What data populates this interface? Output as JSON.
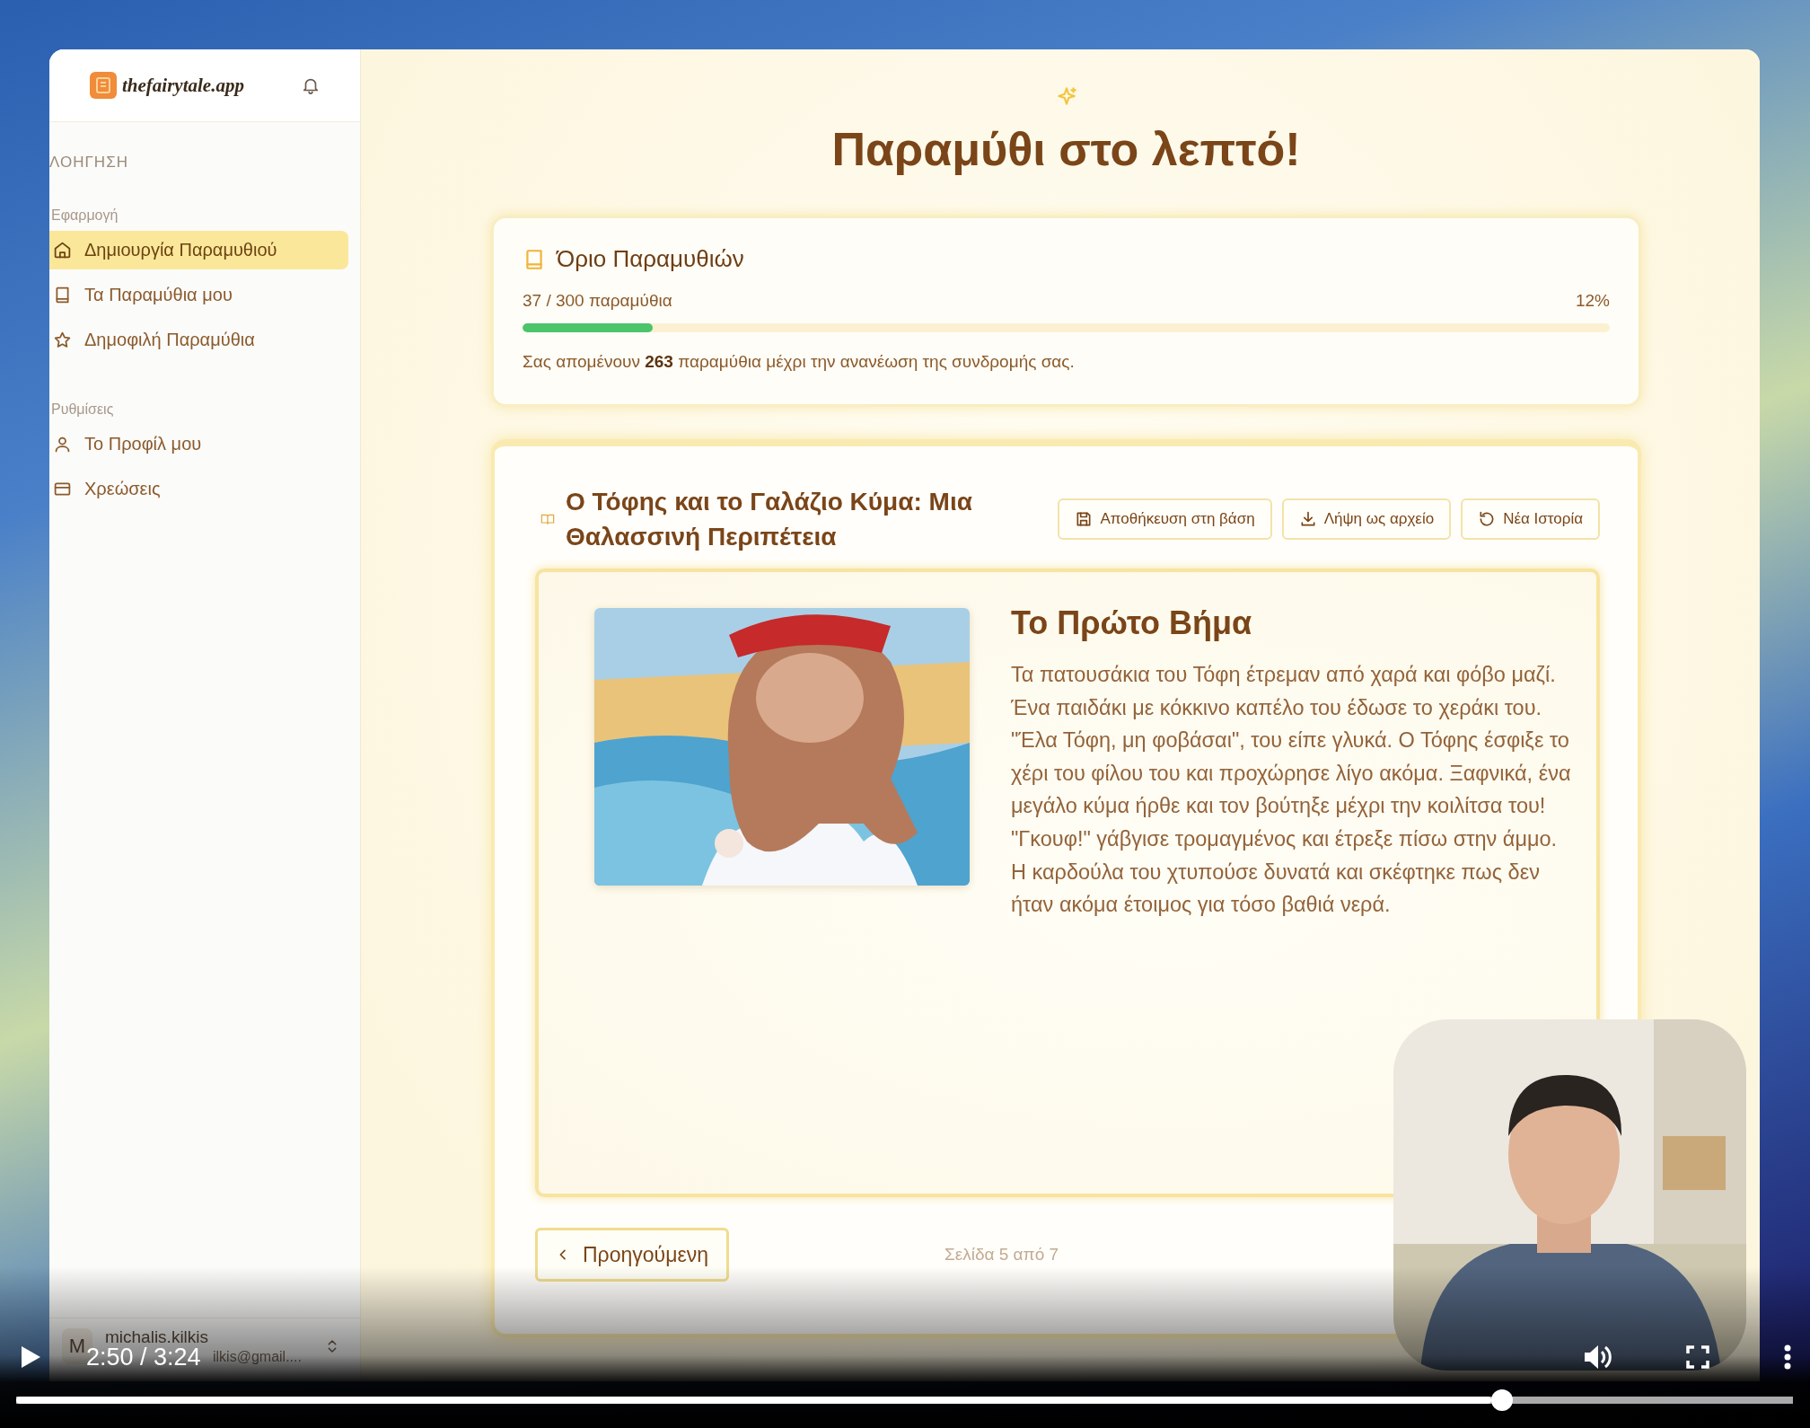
{
  "app": {
    "sidebar": {
      "logo": "thefairytale.app",
      "section_label": "ΛΟΗΓΗΣΗ",
      "groups": [
        {
          "label": "Εφαρμογή",
          "items": [
            {
              "label": "Δημιουργία Παραμυθιού",
              "kind": "home",
              "selected": true
            },
            {
              "label": "Τα Παραμύθια μου",
              "kind": "book",
              "selected": false
            },
            {
              "label": "Δημοφιλή Παραμύθια",
              "kind": "star",
              "selected": false
            }
          ]
        },
        {
          "label": "Ρυθμίσεις",
          "items": [
            {
              "label": "Το Προφίλ μου",
              "kind": "user",
              "selected": false
            },
            {
              "label": "Χρεώσεις",
              "kind": "card",
              "selected": false
            }
          ]
        }
      ],
      "user": {
        "avatar": "M",
        "name": "michalis.kilkis",
        "email": "ilkis@gmail...."
      }
    },
    "main": {
      "title": "Παραμύθι στο λεπτό!",
      "limit_card": {
        "title": "Όριο Παραμυθιών",
        "count": "37 / 300 παραμύθια",
        "percent": "12%",
        "level": 0.12,
        "note": "Σας απομένουν **263** παραμύθια μέχρι την ανανέωση της συνδρομής σας."
      },
      "story": {
        "title": "Ο Τόφης και το Γαλάζιο Κύμα: Μια Θαλασσινή Περιπέτεια",
        "actions": [
          {
            "label": "Αποθήκευση στη βάση",
            "kind": "save"
          },
          {
            "label": "Λήψη ως αρχείο",
            "kind": "download"
          },
          {
            "label": "Νέα Ιστορία",
            "kind": "refresh"
          }
        ],
        "page": {
          "heading": "Το Πρώτο Βήμα",
          "text": "Τα πατουσάκια του Τόφη έτρεμαν από χαρά και φόβο μαζί. Ένα παιδάκι με κόκκινο καπέλο του έδωσε το χεράκι του. \"Έλα Τόφη, μη φοβάσαι\", του είπε γλυκά. Ο Τόφης έσφιξε το χέρι του φίλου του και προχώρησε λίγο ακόμα. Ξαφνικά, ένα μεγάλο κύμα ήρθε και τον βούτηξε μέχρι την κοιλίτσα του! \"Γκουφ!\" γάβγισε τρομαγμένος και έτρεξε πίσω στην άμμο. Η καρδούλα του χτυπούσε δυνατά και σκέφτηκε πως δεν ήταν ακόμα έτοιμος για τόσο βαθιά νερά."
        },
        "previous": "Προηγούμενη",
        "page_indicator": "Σελίδα 5 από 7"
      }
    }
  },
  "video_player": {
    "time": "2:50 / 3:24",
    "level": 0.83
  }
}
